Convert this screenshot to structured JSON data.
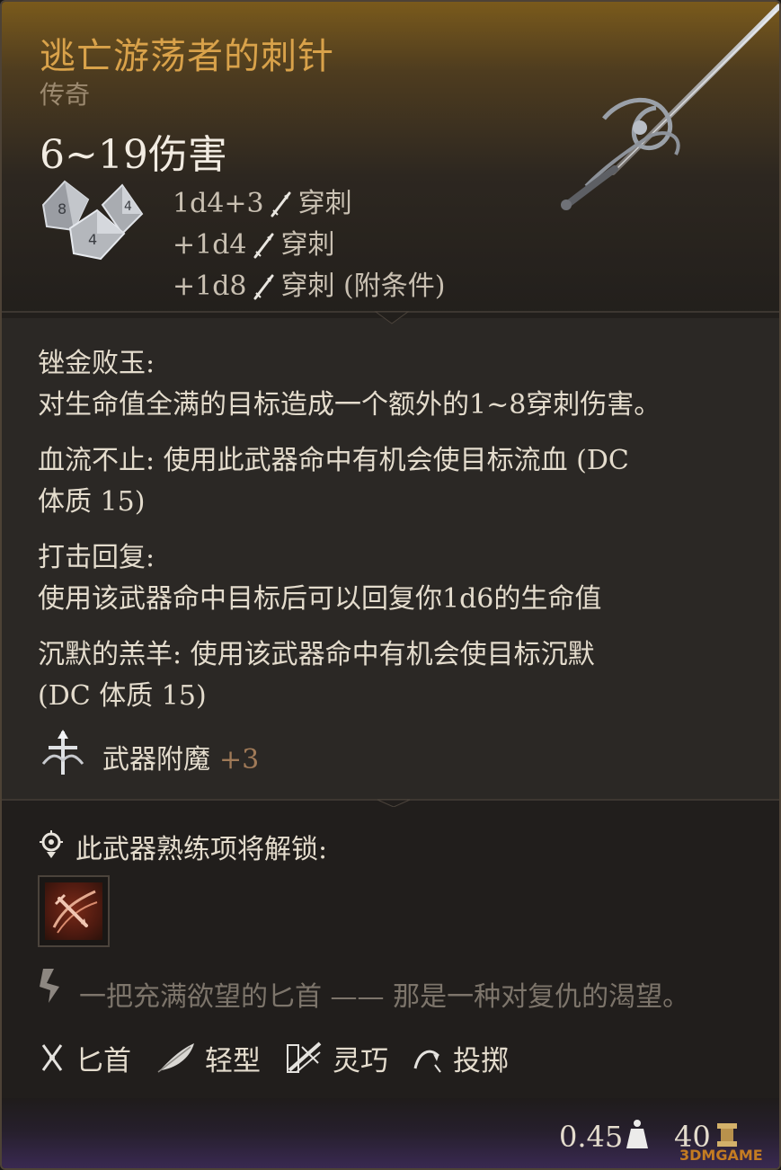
{
  "item": {
    "name": "逃亡游荡者的刺针",
    "rarity": "传奇",
    "damage_total": "6~19伤害",
    "damage_lines": [
      {
        "dice": "1d4+3",
        "type": "穿刺"
      },
      {
        "dice": "+1d4",
        "type": "穿刺"
      },
      {
        "dice": "+1d8",
        "type": "穿刺 (附条件)"
      }
    ]
  },
  "properties": [
    {
      "text_line1": "锉金败玉:",
      "text_line2": "对生命值全满的目标造成一个额外的1~8穿刺伤害。"
    },
    {
      "text_line1": "血流不止: 使用此武器命中有机会使目标流血 (DC",
      "text_line2": "体质 15)"
    },
    {
      "text_line1": "打击回复:",
      "text_line2": "使用该武器命中目标后可以回复你1d6的生命值"
    },
    {
      "text_line1": "沉默的羔羊: 使用该武器命中有机会使目标沉默",
      "text_line2": "(DC 体质 15)"
    }
  ],
  "enchantment": {
    "label": "武器附魔",
    "value": "+3"
  },
  "proficiency": {
    "label": "此武器熟练项将解锁:"
  },
  "flavor": "一把充满欲望的匕首 —— 那是一种对复仇的渴望。",
  "tags": [
    {
      "label": "匕首",
      "icon": "dagger-icon"
    },
    {
      "label": "轻型",
      "icon": "feather-icon"
    },
    {
      "label": "灵巧",
      "icon": "finesse-icon"
    },
    {
      "label": "投掷",
      "icon": "throw-icon"
    }
  ],
  "footer": {
    "weight": "0.45",
    "price": "40",
    "watermark": "3DMGAME"
  },
  "colors": {
    "title": "#d9a24a",
    "rarity": "#9c8a70",
    "enchant_value": "#a07a58"
  }
}
